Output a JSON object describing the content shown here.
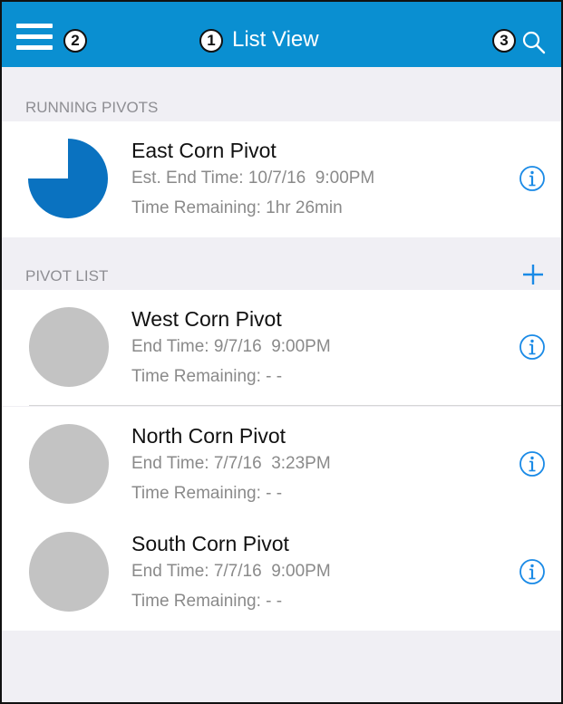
{
  "navbar": {
    "title": "List View",
    "callouts": [
      "1",
      "2",
      "3"
    ],
    "menu_icon": "hamburger-menu-icon",
    "search_icon": "search-icon",
    "background_color": "#0a8fd1"
  },
  "running_section": {
    "header": "RUNNING PIVOTS",
    "items": [
      {
        "name": "East Corn Pivot",
        "line1": "Est. End Time: 10/7/16  9:00PM",
        "line2": "Time Remaining: 1hr 26min",
        "progress": 0.75,
        "progress_color": "#0a72c0",
        "icon": "info-icon"
      }
    ]
  },
  "pivot_section": {
    "header": "PIVOT LIST",
    "add_icon": "plus-icon",
    "items": [
      {
        "name": "West Corn Pivot",
        "line1": "End Time: 9/7/16  9:00PM",
        "line2": "Time Remaining: - -",
        "icon": "info-icon"
      },
      {
        "name": "North Corn Pivot",
        "line1": "End Time: 7/7/16  3:23PM",
        "line2": "Time Remaining: - -",
        "icon": "info-icon"
      },
      {
        "name": "South Corn Pivot",
        "line1": "End Time: 7/7/16  9:00PM",
        "line2": "Time Remaining: - -",
        "icon": "info-icon"
      }
    ]
  },
  "accent_color": "#1a8ae6"
}
